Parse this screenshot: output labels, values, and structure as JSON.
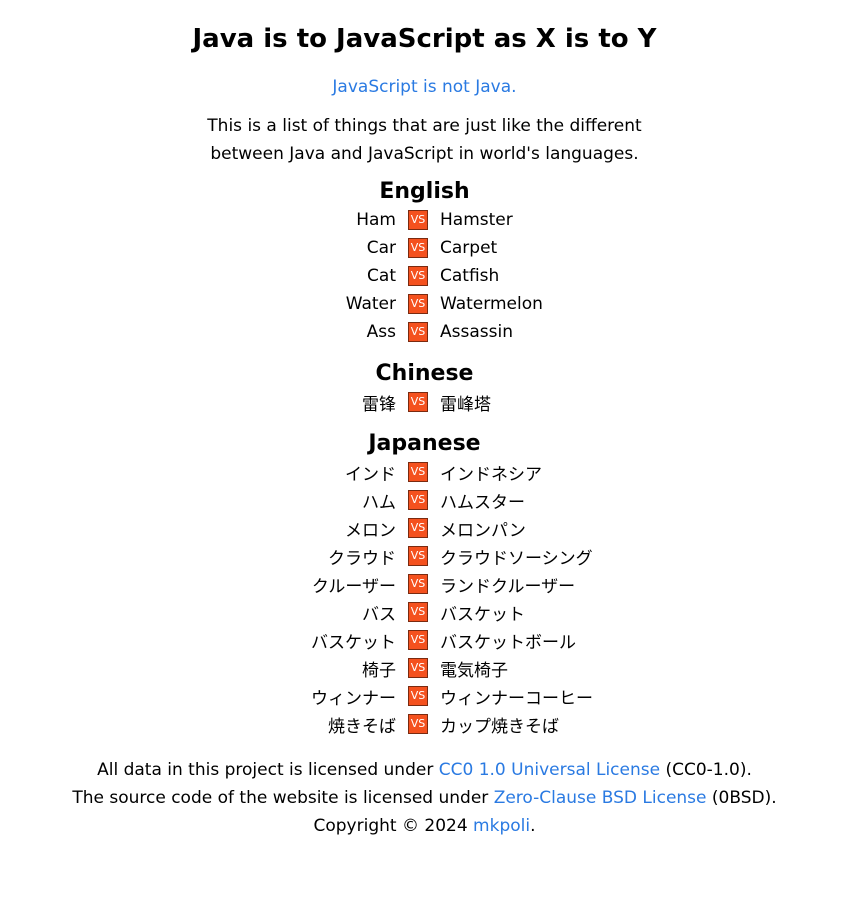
{
  "title": "Java is to JavaScript as X is to Y",
  "subtitle_link": "JavaScript is not Java.",
  "description": "This is a list of things that are just like the different between Java and JavaScript in world's languages.",
  "vs_label": "VS",
  "sections": [
    {
      "name": "English",
      "pairs": [
        [
          "Ham",
          "Hamster"
        ],
        [
          "Car",
          "Carpet"
        ],
        [
          "Cat",
          "Catfish"
        ],
        [
          "Water",
          "Watermelon"
        ],
        [
          "Ass",
          "Assassin"
        ]
      ]
    },
    {
      "name": "Chinese",
      "pairs": [
        [
          "雷锋",
          "雷峰塔"
        ]
      ]
    },
    {
      "name": "Japanese",
      "pairs": [
        [
          "インド",
          "インドネシア"
        ],
        [
          "ハム",
          "ハムスター"
        ],
        [
          "メロン",
          "メロンパン"
        ],
        [
          "クラウド",
          "クラウドソーシング"
        ],
        [
          "クルーザー",
          "ランドクルーザー"
        ],
        [
          "バス",
          "バスケット"
        ],
        [
          "バスケット",
          "バスケットボール"
        ],
        [
          "椅子",
          "電気椅子"
        ],
        [
          "ウィンナー",
          "ウィンナーコーヒー"
        ],
        [
          "焼きそば",
          "カップ焼きそば"
        ]
      ]
    }
  ],
  "footer": {
    "line1_pre": "All data in this project is licensed under ",
    "line1_link": "CC0 1.0 Universal License",
    "line1_post": " (CC0-1.0).",
    "line2_pre": "The source code of the website is licensed under ",
    "line2_link": "Zero-Clause BSD License",
    "line2_post": " (0BSD).",
    "line3_pre": "Copyright © 2024 ",
    "line3_link": "mkpoli",
    "line3_post": "."
  },
  "colors": {
    "vs_badge": "#f4511e",
    "link": "#2a7ae2"
  }
}
